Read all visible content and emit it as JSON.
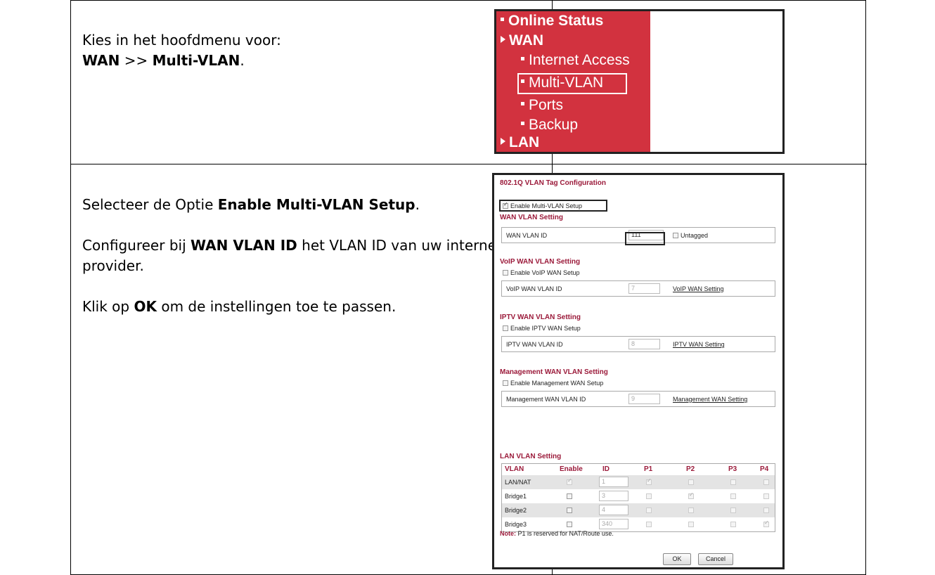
{
  "step1": {
    "line1": "Kies in het hoofdmenu voor:",
    "wan": "WAN",
    "sep": " >> ",
    "multivlan": "Multi-VLAN",
    "end": "."
  },
  "step2": {
    "p1_pre": "Selecteer de Optie ",
    "p1_bold": "Enable Multi-VLAN Setup",
    "p1_post": ".",
    "p2_pre": "Configureer bij ",
    "p2_bold": "WAN VLAN ID",
    "p2_post": " het VLAN ID van uw internet provider.",
    "p3_pre": "Klik op ",
    "p3_bold": "OK",
    "p3_post": " om de instellingen toe te passen."
  },
  "menu": {
    "online_status": "Online Status",
    "wan": "WAN",
    "internet_access": "Internet Access",
    "multi_vlan": "Multi-VLAN",
    "ports": "Ports",
    "backup": "Backup",
    "lan": "LAN",
    "bg_color": "#d2323f"
  },
  "config": {
    "title": "802.1Q VLAN Tag Configuration",
    "enable_multi": "Enable Multi-VLAN Setup",
    "wan_section": "WAN VLAN Setting",
    "wan_id_label": "WAN VLAN ID",
    "wan_id_value": "111",
    "untagged": "Untagged",
    "voip_section": "VoIP WAN VLAN Setting",
    "voip_enable": "Enable VoIP WAN Setup",
    "voip_id_label": "VoIP WAN VLAN ID",
    "voip_id_value": "7",
    "voip_link": "VoIP WAN Setting",
    "iptv_section": "IPTV WAN VLAN Setting",
    "iptv_enable": "Enable IPTV WAN Setup",
    "iptv_id_label": "IPTV WAN VLAN ID",
    "iptv_id_value": "8",
    "iptv_link": "IPTV WAN Setting",
    "mgmt_section": "Management WAN VLAN Setting",
    "mgmt_enable": "Enable Management WAN Setup",
    "mgmt_id_label": "Management WAN VLAN ID",
    "mgmt_id_value": "9",
    "mgmt_link": "Management WAN Setting",
    "lan_section": "LAN VLAN Setting",
    "lan_headers": [
      "VLAN",
      "Enable",
      "ID",
      "P1",
      "P2",
      "P3",
      "P4"
    ],
    "lan_rows": [
      {
        "name": "LAN/NAT",
        "enable": true,
        "id": "1",
        "p1": true,
        "p2": false,
        "p3": false,
        "p4": false
      },
      {
        "name": "Bridge1",
        "enable": false,
        "id": "3",
        "p1": false,
        "p2": true,
        "p3": false,
        "p4": false
      },
      {
        "name": "Bridge2",
        "enable": false,
        "id": "4",
        "p1": false,
        "p2": false,
        "p3": false,
        "p4": false
      },
      {
        "name": "Bridge3",
        "enable": false,
        "id": "340",
        "p1": false,
        "p2": false,
        "p3": false,
        "p4": true
      }
    ],
    "note_label": "Note:",
    "note_text": " P1 is reserved for NAT/Route use.",
    "ok": "OK",
    "cancel": "Cancel"
  }
}
